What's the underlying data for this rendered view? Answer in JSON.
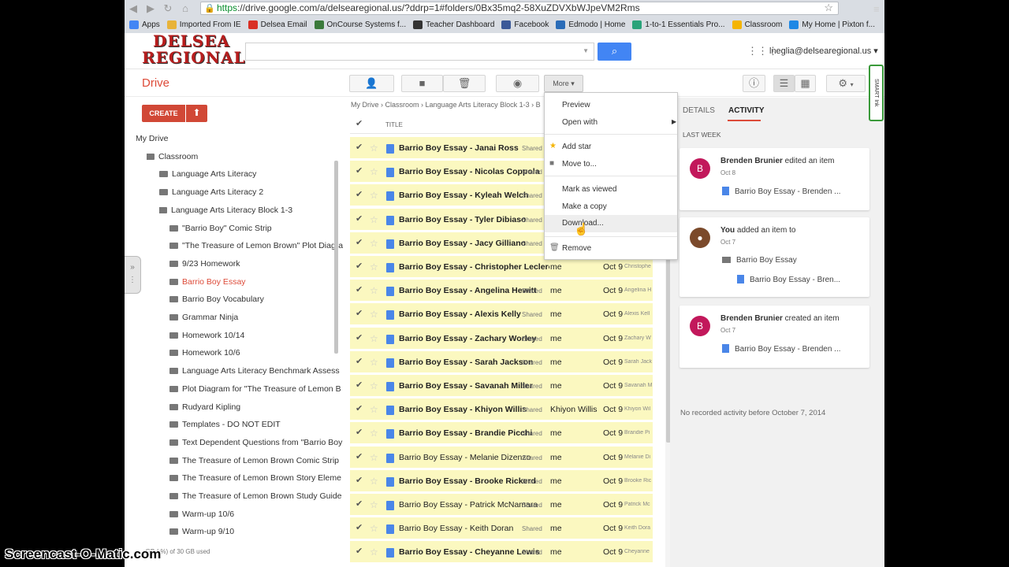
{
  "browser": {
    "url_https": "https",
    "url_rest": "://drive.google.com/a/delsearegional.us/?ddrp=1#folders/0Bx35mq2-58XuZDVXbWJpeVM2Rms",
    "bookmarks": [
      {
        "label": "Apps",
        "color": "#4285f4"
      },
      {
        "label": "Imported From IE",
        "color": "#e8b339"
      },
      {
        "label": "Delsea Email",
        "color": "#d93025"
      },
      {
        "label": "OnCourse Systems f...",
        "color": "#3b7a3b"
      },
      {
        "label": "Teacher Dashboard",
        "color": "#333333"
      },
      {
        "label": "Facebook",
        "color": "#3b5998"
      },
      {
        "label": "Edmodo | Home",
        "color": "#2a6cb8"
      },
      {
        "label": "1-to-1 Essentials Pro...",
        "color": "#2aa37a"
      },
      {
        "label": "Classroom",
        "color": "#f4b400"
      },
      {
        "label": "My Home | Pixton f...",
        "color": "#1e88e5"
      }
    ]
  },
  "header": {
    "logo_line1": "DELSEA",
    "logo_line2": "REGIONAL",
    "account": "lneglia@delsearegional.us ▾"
  },
  "drive": {
    "title": "Drive",
    "more_label": "More ▾",
    "create_label": "CREATE"
  },
  "sidebar": {
    "items": [
      {
        "label": "My Drive",
        "level": 0,
        "arrow": "▾",
        "active": false
      },
      {
        "label": "Classroom",
        "level": 1,
        "arrow": "▾",
        "active": false
      },
      {
        "label": "Language Arts Literacy",
        "level": 2,
        "arrow": "",
        "active": false
      },
      {
        "label": "Language Arts Literacy 2",
        "level": 2,
        "arrow": "",
        "active": false
      },
      {
        "label": "Language Arts Literacy Block 1-3",
        "level": 2,
        "arrow": "▾",
        "active": false
      },
      {
        "label": "\"Barrio Boy\" Comic Strip",
        "level": 3,
        "arrow": "",
        "active": false
      },
      {
        "label": "\"The Treasure of Lemon Brown\" Plot Diagra",
        "level": 3,
        "arrow": "",
        "active": false
      },
      {
        "label": "9/23 Homework",
        "level": 3,
        "arrow": "",
        "active": false
      },
      {
        "label": "Barrio Boy Essay",
        "level": 3,
        "arrow": "",
        "active": true
      },
      {
        "label": "Barrio Boy Vocabulary",
        "level": 3,
        "arrow": "",
        "active": false
      },
      {
        "label": "Grammar Ninja",
        "level": 3,
        "arrow": "",
        "active": false
      },
      {
        "label": "Homework 10/14",
        "level": 3,
        "arrow": "",
        "active": false
      },
      {
        "label": "Homework 10/6",
        "level": 3,
        "arrow": "",
        "active": false
      },
      {
        "label": "Language Arts Literacy Benchmark Assess",
        "level": 3,
        "arrow": "",
        "active": false
      },
      {
        "label": "Plot Diagram for \"The Treasure of Lemon B",
        "level": 3,
        "arrow": "",
        "active": false
      },
      {
        "label": "Rudyard Kipling",
        "level": 3,
        "arrow": "",
        "active": false
      },
      {
        "label": "Templates - DO NOT EDIT",
        "level": 3,
        "arrow": "",
        "active": false
      },
      {
        "label": "Text Dependent Questions from \"Barrio Boy",
        "level": 3,
        "arrow": "",
        "active": false
      },
      {
        "label": "The Treasure of Lemon Brown Comic Strip",
        "level": 3,
        "arrow": "",
        "active": false
      },
      {
        "label": "The Treasure of Lemon Brown Story Eleme",
        "level": 3,
        "arrow": "",
        "active": false
      },
      {
        "label": "The Treasure of Lemon Brown Study Guide",
        "level": 3,
        "arrow": "",
        "active": false
      },
      {
        "label": "Warm-up 10/6",
        "level": 3,
        "arrow": "",
        "active": false
      },
      {
        "label": "Warm-up 9/10",
        "level": 3,
        "arrow": "",
        "active": false
      }
    ],
    "storage": "...GB (.%) of 30 GB used"
  },
  "main": {
    "breadcrumb": "My Drive  ›  Classroom  ›  Language Arts Literacy Block 1-3  ›  B",
    "title_header": "TITLE",
    "rows": [
      {
        "name": "Barrio Boy Essay - Janai Ross",
        "bold": true,
        "shared": "Shared",
        "owner": "",
        "date": "",
        "by": ""
      },
      {
        "name": "Barrio Boy Essay - Nicolas Coppola",
        "bold": true,
        "shared": "Shared",
        "owner": "",
        "date": "",
        "by": ""
      },
      {
        "name": "Barrio Boy Essay - Kyleah Welch",
        "bold": true,
        "shared": "Shared",
        "owner": "",
        "date": "",
        "by": ""
      },
      {
        "name": "Barrio Boy Essay - Tyler Dibiaso",
        "bold": true,
        "shared": "Shared",
        "owner": "",
        "date": "",
        "by": ""
      },
      {
        "name": "Barrio Boy Essay - Jacy Gilliano",
        "bold": true,
        "shared": "Shared",
        "owner": "",
        "date": "",
        "by": ""
      },
      {
        "name": "Barrio Boy Essay - Christopher Leclercq",
        "bold": true,
        "shared": "",
        "owner": "me",
        "date": "Oct 9",
        "by": "Christophe"
      },
      {
        "name": "Barrio Boy Essay - Angelina Hewitt",
        "bold": true,
        "shared": "Shared",
        "owner": "me",
        "date": "Oct 9",
        "by": "Angelina H"
      },
      {
        "name": "Barrio Boy Essay - Alexis Kelly",
        "bold": true,
        "shared": "Shared",
        "owner": "me",
        "date": "Oct 9",
        "by": "Alexis Kell"
      },
      {
        "name": "Barrio Boy Essay - Zachary Worley",
        "bold": true,
        "shared": "Shared",
        "owner": "me",
        "date": "Oct 9",
        "by": "Zachary W"
      },
      {
        "name": "Barrio Boy Essay - Sarah Jackson",
        "bold": true,
        "shared": "Shared",
        "owner": "me",
        "date": "Oct 9",
        "by": "Sarah Jack"
      },
      {
        "name": "Barrio Boy Essay - Savanah Miller",
        "bold": true,
        "shared": "Shared",
        "owner": "me",
        "date": "Oct 9",
        "by": "Savanah M"
      },
      {
        "name": "Barrio Boy Essay - Khiyon Willis",
        "bold": true,
        "shared": "Shared",
        "owner": "Khiyon Willis",
        "date": "Oct 9",
        "by": "Khiyon Wil"
      },
      {
        "name": "Barrio Boy Essay - Brandie Picchi",
        "bold": true,
        "shared": "Shared",
        "owner": "me",
        "date": "Oct 9",
        "by": "Brandie Pi"
      },
      {
        "name": "Barrio Boy Essay - Melanie Dizenzo",
        "bold": false,
        "shared": "Shared",
        "owner": "me",
        "date": "Oct 9",
        "by": "Melanie Di"
      },
      {
        "name": "Barrio Boy Essay - Brooke Rickerd",
        "bold": true,
        "shared": "Shared",
        "owner": "me",
        "date": "Oct 9",
        "by": "Brooke Ric"
      },
      {
        "name": "Barrio Boy Essay - Patrick McNamara",
        "bold": false,
        "shared": "Shared",
        "owner": "me",
        "date": "Oct 9",
        "by": "Patrick Mc"
      },
      {
        "name": "Barrio Boy Essay - Keith Doran",
        "bold": false,
        "shared": "Shared",
        "owner": "me",
        "date": "Oct 9",
        "by": "Keith Dora"
      },
      {
        "name": "Barrio Boy Essay - Cheyanne Lewis",
        "bold": true,
        "shared": "Shared",
        "owner": "me",
        "date": "Oct 9",
        "by": "Cheyanne"
      }
    ]
  },
  "context_menu": {
    "preview": "Preview",
    "open_with": "Open with",
    "add_star": "Add star",
    "move_to": "Move to...",
    "mark_viewed": "Mark as viewed",
    "make_copy": "Make a copy",
    "download": "Download...",
    "remove": "Remove"
  },
  "details": {
    "tab_details": "DETAILS",
    "tab_activity": "ACTIVITY",
    "last_week": "LAST WEEK",
    "card1": {
      "avatar": "B",
      "who": "Brenden Brunier",
      "action": " edited an item",
      "when": "Oct 8",
      "item": "Barrio Boy Essay - Brenden ..."
    },
    "card2": {
      "who": "You",
      "action": " added an item to",
      "when": "Oct 7",
      "folder": "Barrio Boy Essay",
      "item": "Barrio Boy Essay - Bren..."
    },
    "card3": {
      "avatar": "B",
      "who": "Brenden Brunier",
      "action": " created an item",
      "when": "Oct 7",
      "item": "Barrio Boy Essay - Brenden ..."
    },
    "no_record": "No recorded activity before October 7, 2014"
  },
  "smart_ink": "SMART Ink",
  "watermark": "Screencast-O-Matic.com"
}
